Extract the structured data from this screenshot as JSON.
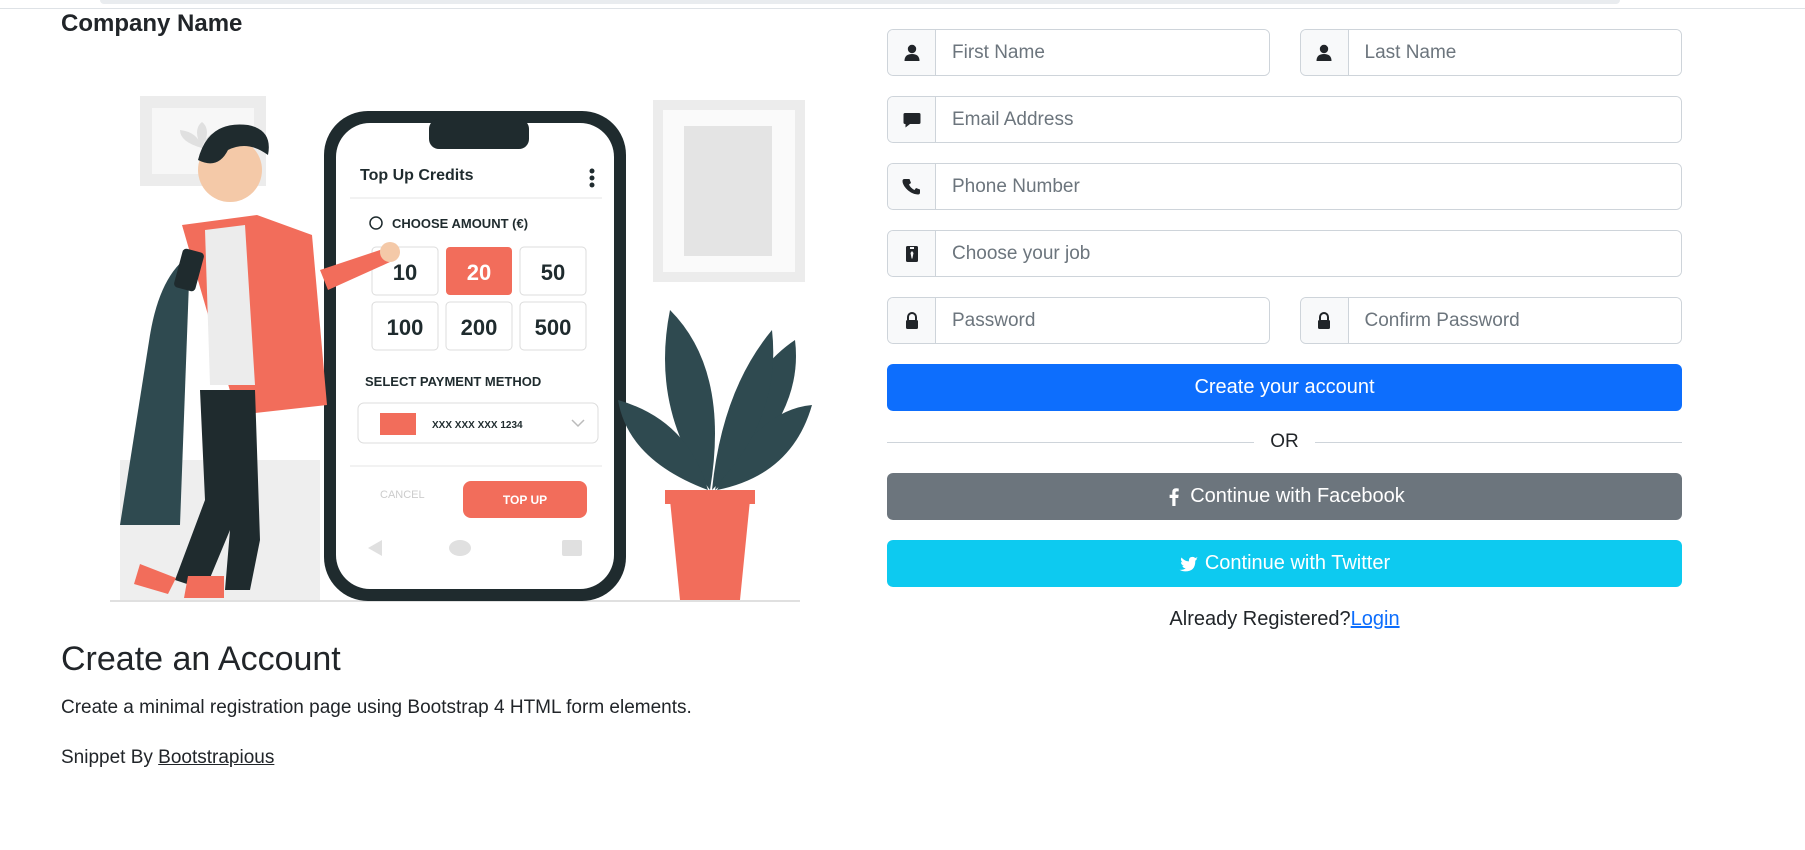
{
  "header": {
    "company_name": "Company Name"
  },
  "illustration": {
    "phone_title": "Top Up Credits",
    "choose_amount_label": "CHOOSE AMOUNT (€)",
    "amounts": [
      "10",
      "20",
      "50",
      "100",
      "200",
      "500"
    ],
    "selected_amount": "20",
    "payment_label": "SELECT PAYMENT METHOD",
    "card_number": "XXX XXX XXX 1234",
    "cancel_label": "CANCEL",
    "top_up_label": "TOP UP",
    "accent_color": "#f26d5b"
  },
  "intro": {
    "title": "Create an Account",
    "description": "Create a minimal registration page using Bootstrap 4 HTML form elements.",
    "snippet_prefix": "Snippet By ",
    "snippet_link": "Bootstrapious"
  },
  "form": {
    "first_name": {
      "placeholder": "First Name",
      "value": ""
    },
    "last_name": {
      "placeholder": "Last Name",
      "value": ""
    },
    "email": {
      "placeholder": "Email Address",
      "value": ""
    },
    "phone": {
      "placeholder": "Phone Number",
      "value": ""
    },
    "job": {
      "placeholder": "Choose your job",
      "value": ""
    },
    "password": {
      "placeholder": "Password",
      "value": ""
    },
    "confirm_password": {
      "placeholder": "Confirm Password",
      "value": ""
    },
    "submit_label": "Create your account",
    "or_label": "OR",
    "facebook_label": "Continue with Facebook",
    "twitter_label": "Continue with Twitter",
    "already_text": "Already Registered?",
    "login_label": "Login"
  },
  "colors": {
    "primary": "#0d6efd",
    "secondary": "#6c757d",
    "info": "#0dcaf0"
  }
}
